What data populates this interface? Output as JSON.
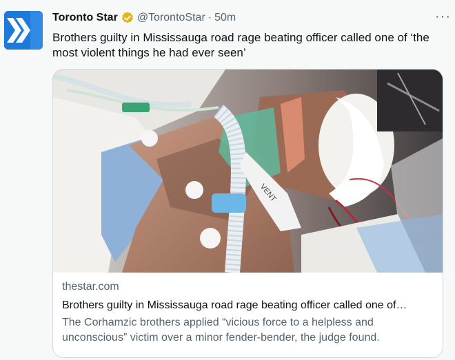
{
  "tweet": {
    "author_name": "Toronto Star",
    "author_handle": "@TorontoStar",
    "separator": "·",
    "time": "50m",
    "more": "···",
    "text": "Brothers guilty in Mississauga road rage beating officer called one of ‘the most violent things he had ever seen’"
  },
  "card": {
    "domain": "thestar.com",
    "title": "Brothers guilty in Mississauga road rage beating officer called one of…",
    "description": "The Corhamzic brothers applied “vicious force to a helpless and unconscious” victim over a minor fender-bender, the judge found.",
    "photo_tube_label": "VENT"
  },
  "colors": {
    "brand": "#1d7ad8",
    "verified_gold": "#e2b719",
    "secondary_text": "#536471"
  },
  "icons": {
    "avatar": "toronto-star-chevron-logo",
    "verified": "verified-badge-icon",
    "more": "more-options-icon"
  }
}
